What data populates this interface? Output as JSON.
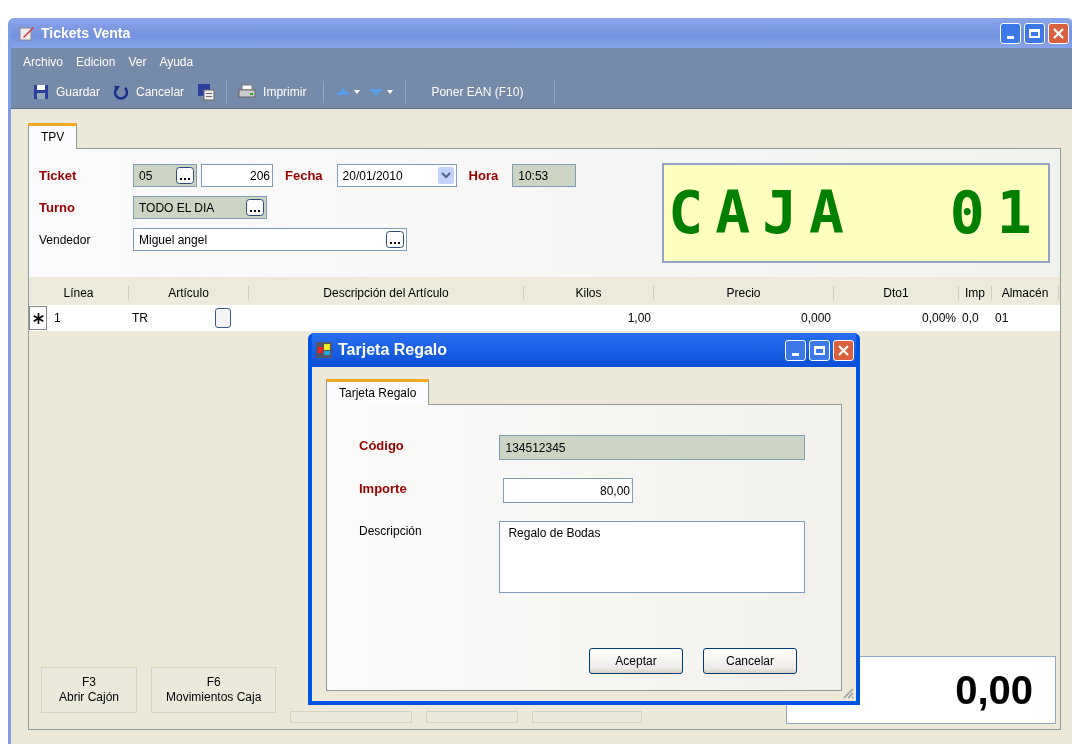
{
  "window": {
    "title": "Tickets Venta"
  },
  "menu": [
    "Archivo",
    "Edicion",
    "Ver",
    "Ayuda"
  ],
  "toolbar": [
    {
      "kind": "save",
      "label": "Guardar"
    },
    {
      "kind": "undo",
      "label": "Cancelar"
    },
    {
      "kind": "card"
    },
    {
      "kind": "separator"
    },
    {
      "kind": "print",
      "label": "Imprimir"
    },
    {
      "kind": "separator"
    },
    {
      "kind": "up"
    },
    {
      "kind": "down"
    },
    {
      "kind": "separator"
    },
    {
      "kind": "text",
      "label": "Poner EAN (F10)"
    },
    {
      "kind": "separator"
    }
  ],
  "tabs": [
    {
      "label": "TPV",
      "selected": true
    }
  ],
  "form": {
    "ticket": {
      "label": "Ticket",
      "required": true,
      "series": "05",
      "number": "206"
    },
    "fecha": {
      "label": "Fecha",
      "required": true,
      "value": "20/01/2010"
    },
    "hora": {
      "label": "Hora",
      "required": true,
      "value": "10:53"
    },
    "turno": {
      "label": "Turno",
      "required": true,
      "value": "TODO EL DIA"
    },
    "vendedor": {
      "label": "Vendedor",
      "required": false,
      "value": "Miguel angel"
    }
  },
  "display": "CAJA  01",
  "table": {
    "columns": [
      "Línea",
      "Artículo",
      "Descripción del Artículo",
      "Kilos",
      "Precio",
      "Dto1",
      "Imp",
      "Almacén"
    ],
    "rows": [
      {
        "new": true,
        "linea": "1",
        "articulo": "TR",
        "kilos": "1,00",
        "precio": "0,000",
        "dto1": "0,00%",
        "imp": "0,0",
        "almacen": "01"
      }
    ]
  },
  "bottom_buttons": [
    {
      "key": "F3",
      "label": "Abrir Cajón"
    },
    {
      "key": "F6",
      "label": "Movimientos Caja"
    }
  ],
  "total": "0,00",
  "dialog": {
    "title": "Tarjeta Regalo",
    "tabs": [
      {
        "label": "Tarjeta Regalo",
        "selected": true
      }
    ],
    "fields": [
      {
        "kind": "text",
        "label": "Código",
        "required": true,
        "readonly": true,
        "value": "134512345"
      },
      {
        "kind": "amount",
        "label": "Importe",
        "required": true,
        "readonly": false,
        "value": "80,00"
      },
      {
        "kind": "memo",
        "label": "Descripción",
        "required": false,
        "readonly": false,
        "value": "Regalo de Bodas"
      }
    ],
    "buttons": [
      "Aceptar",
      "Cancelar"
    ]
  }
}
